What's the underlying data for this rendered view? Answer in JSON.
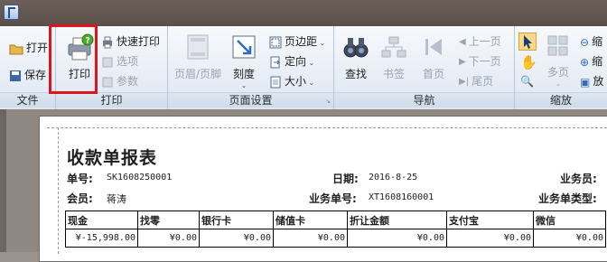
{
  "window": {
    "icon": "app-icon"
  },
  "ribbon": {
    "groups": {
      "file": {
        "label": "文件",
        "open": "打开",
        "save": "保存"
      },
      "print": {
        "label": "打印",
        "print": "打印",
        "quick_print": "快速打印",
        "options": "选项",
        "params": "参数"
      },
      "page_setup": {
        "label": "页面设置",
        "header_footer": "页眉/页脚",
        "scale": "刻度",
        "margins": "页边距",
        "orientation": "定向",
        "size": "大小"
      },
      "navigation": {
        "label": "导航",
        "find": "查找",
        "bookmark": "书签",
        "first": "首页",
        "prev": "上一页",
        "next": "下一页",
        "last": "尾页"
      },
      "zoom": {
        "label": "缩放",
        "multi_page": "多页",
        "z1": "缩",
        "z2": "缩",
        "z3": "放"
      }
    }
  },
  "report": {
    "title": "收款单报表",
    "bill_no_label": "单号:",
    "bill_no": "SK1608250001",
    "date_label": "日期:",
    "date": "2016-8-25",
    "staff_label": "业务员:",
    "member_label": "会员:",
    "member": "蒋涛",
    "biz_no_label": "业务单号:",
    "biz_no": "XT1608160001",
    "biz_type_label": "业务单类型:",
    "columns": [
      "现金",
      "找零",
      "银行卡",
      "储值卡",
      "折让金额",
      "支付宝",
      "微信"
    ],
    "values": [
      "¥-15,998.00",
      "¥0.00",
      "¥0.00",
      "¥0.00",
      "¥0.00",
      "¥0.00",
      "¥0.00"
    ]
  },
  "colors": {
    "highlight": "#e0141c",
    "ribbon_bg": "#e8eef6",
    "titlebar": "#5f544e"
  }
}
